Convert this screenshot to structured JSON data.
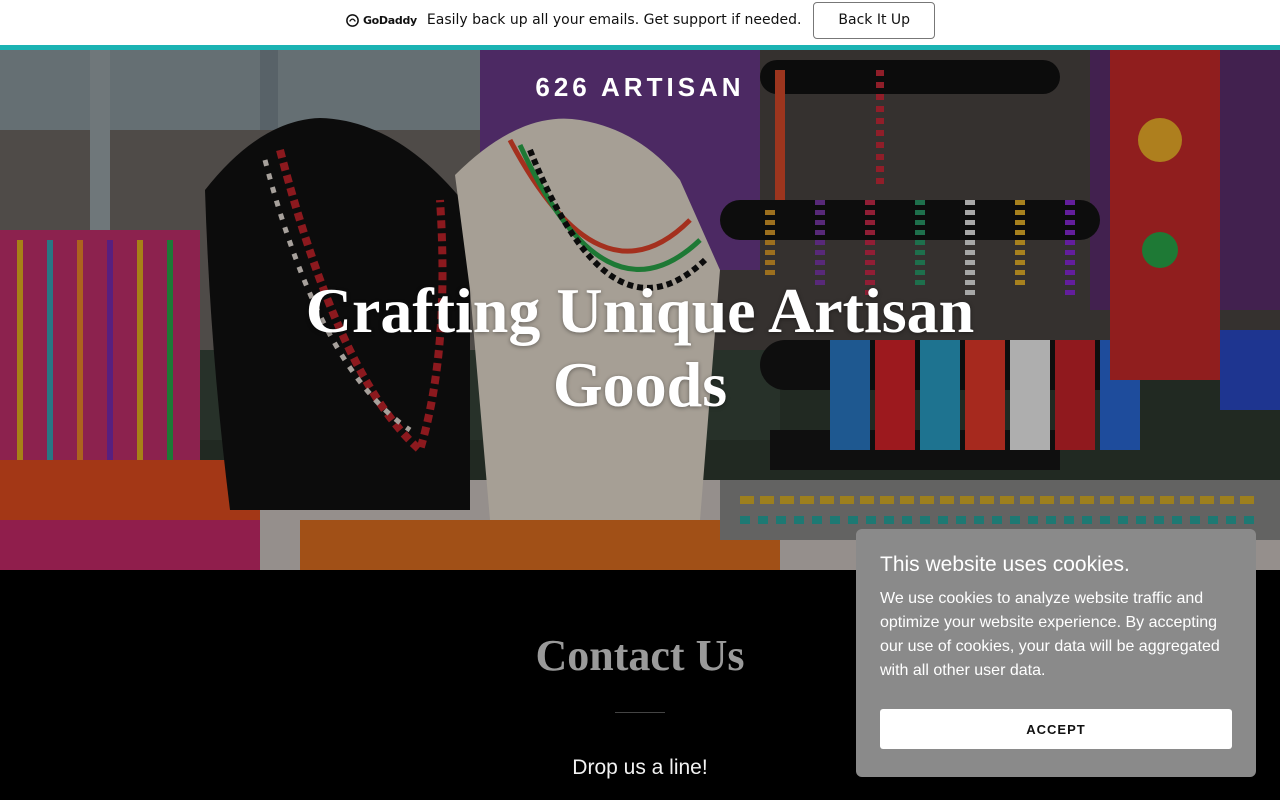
{
  "promo": {
    "logo_text": "GoDaddy",
    "message": "Easily back up all your emails. Get support if needed.",
    "button_label": "Back It Up"
  },
  "hero": {
    "site_title": "626 ARTISAN",
    "heading": "Crafting Unique Artisan Goods"
  },
  "contact": {
    "title": "Contact Us",
    "subtitle": "Drop us a line!"
  },
  "cookie": {
    "title": "This website uses cookies.",
    "body": "We use cookies to analyze website traffic and optimize your website experience. By accepting our use of cookies, your data will be aggregated with all other user data.",
    "accept_label": "ACCEPT"
  },
  "colors": {
    "accent": "#1bb3b3",
    "cookie_bg": "#8a8a8a",
    "contact_title": "#9a9a9a"
  }
}
